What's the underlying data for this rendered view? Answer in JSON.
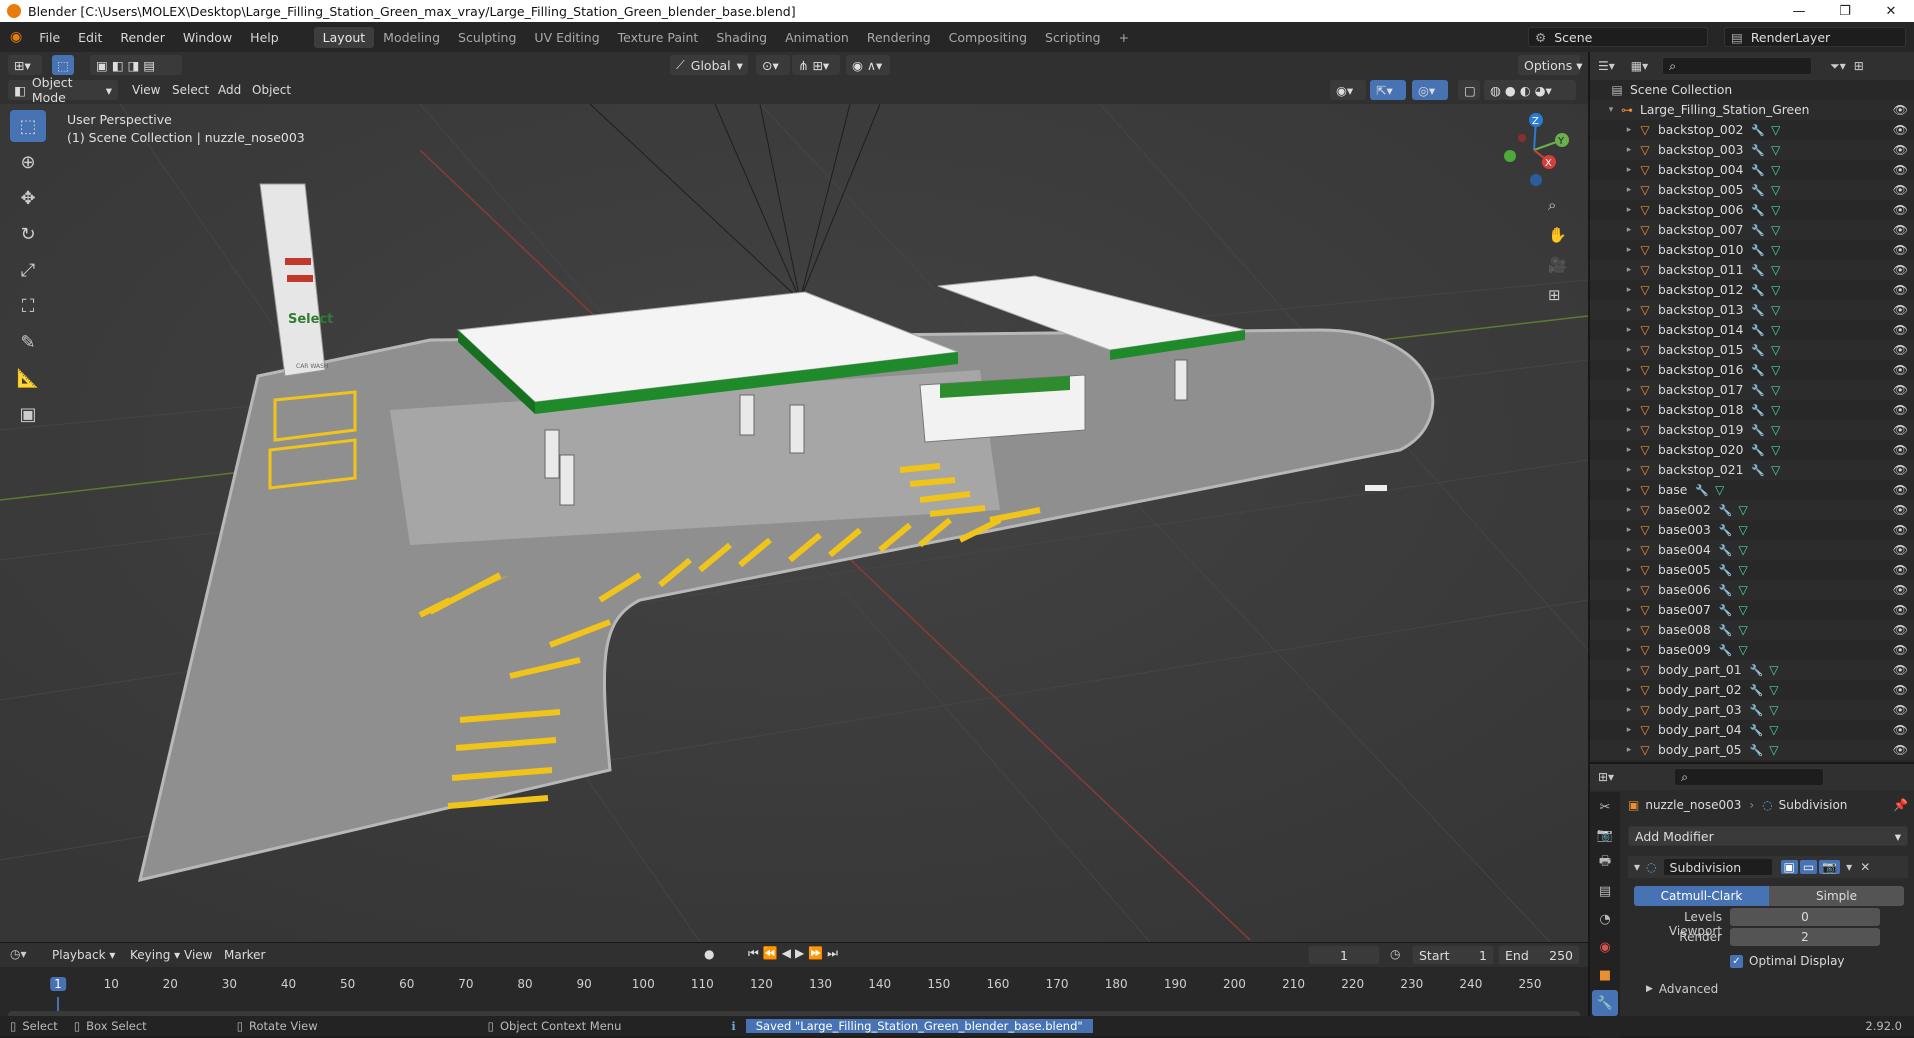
{
  "window": {
    "title": "Blender [C:\\Users\\MOLEX\\Desktop\\Large_Filling_Station_Green_max_vray/Large_Filling_Station_Green_blender_base.blend]"
  },
  "menu": [
    "File",
    "Edit",
    "Render",
    "Window",
    "Help"
  ],
  "workspaces": [
    "Layout",
    "Modeling",
    "Sculpting",
    "UV Editing",
    "Texture Paint",
    "Shading",
    "Animation",
    "Rendering",
    "Compositing",
    "Scripting"
  ],
  "scene": {
    "name": "Scene",
    "render_layer": "RenderLayer"
  },
  "viewport_header": {
    "transform": "Global",
    "options": "Options",
    "mode": "Object Mode",
    "menus": [
      "View",
      "Select",
      "Add",
      "Object"
    ]
  },
  "viewport": {
    "perspective": "User Perspective",
    "context": "(1) Scene Collection | nuzzle_nose003"
  },
  "gizmo": {
    "x": "X",
    "y": "Y",
    "z": "Z"
  },
  "scene_signs": {
    "a": "Select",
    "b": "CAR WASH"
  },
  "outliner": {
    "root": "Scene Collection",
    "collection": "Large_Filling_Station_Green",
    "items": [
      "backstop_002",
      "backstop_003",
      "backstop_004",
      "backstop_005",
      "backstop_006",
      "backstop_007",
      "backstop_010",
      "backstop_011",
      "backstop_012",
      "backstop_013",
      "backstop_014",
      "backstop_015",
      "backstop_016",
      "backstop_017",
      "backstop_018",
      "backstop_019",
      "backstop_020",
      "backstop_021",
      "base",
      "base002",
      "base003",
      "base004",
      "base005",
      "base006",
      "base007",
      "base008",
      "base009",
      "body_part_01",
      "body_part_02",
      "body_part_03",
      "body_part_04",
      "body_part_05"
    ]
  },
  "properties": {
    "object": "nuzzle_nose003",
    "modifier_tab": "Subdivision",
    "add_modifier": "Add Modifier",
    "modifier_name": "Subdivision",
    "type_a": "Catmull-Clark",
    "type_b": "Simple",
    "levels_viewport_label": "Levels Viewport",
    "levels_viewport": "0",
    "render_label": "Render",
    "render": "2",
    "optimal_display": "Optimal Display",
    "advanced": "Advanced"
  },
  "timeline": {
    "menus": [
      "Playback",
      "Keying",
      "View",
      "Marker"
    ],
    "current_frame": "1",
    "start_label": "Start",
    "start": "1",
    "end_label": "End",
    "end": "250",
    "ticks": [
      "1",
      "10",
      "20",
      "30",
      "40",
      "50",
      "60",
      "70",
      "80",
      "90",
      "100",
      "110",
      "120",
      "130",
      "140",
      "150",
      "160",
      "170",
      "180",
      "190",
      "200",
      "210",
      "220",
      "230",
      "240",
      "250"
    ]
  },
  "status": {
    "select": "Select",
    "box_select": "Box Select",
    "rotate": "Rotate View",
    "context_menu": "Object Context Menu",
    "message": "Saved \"Large_Filling_Station_Green_blender_base.blend\"",
    "version": "2.92.0"
  }
}
